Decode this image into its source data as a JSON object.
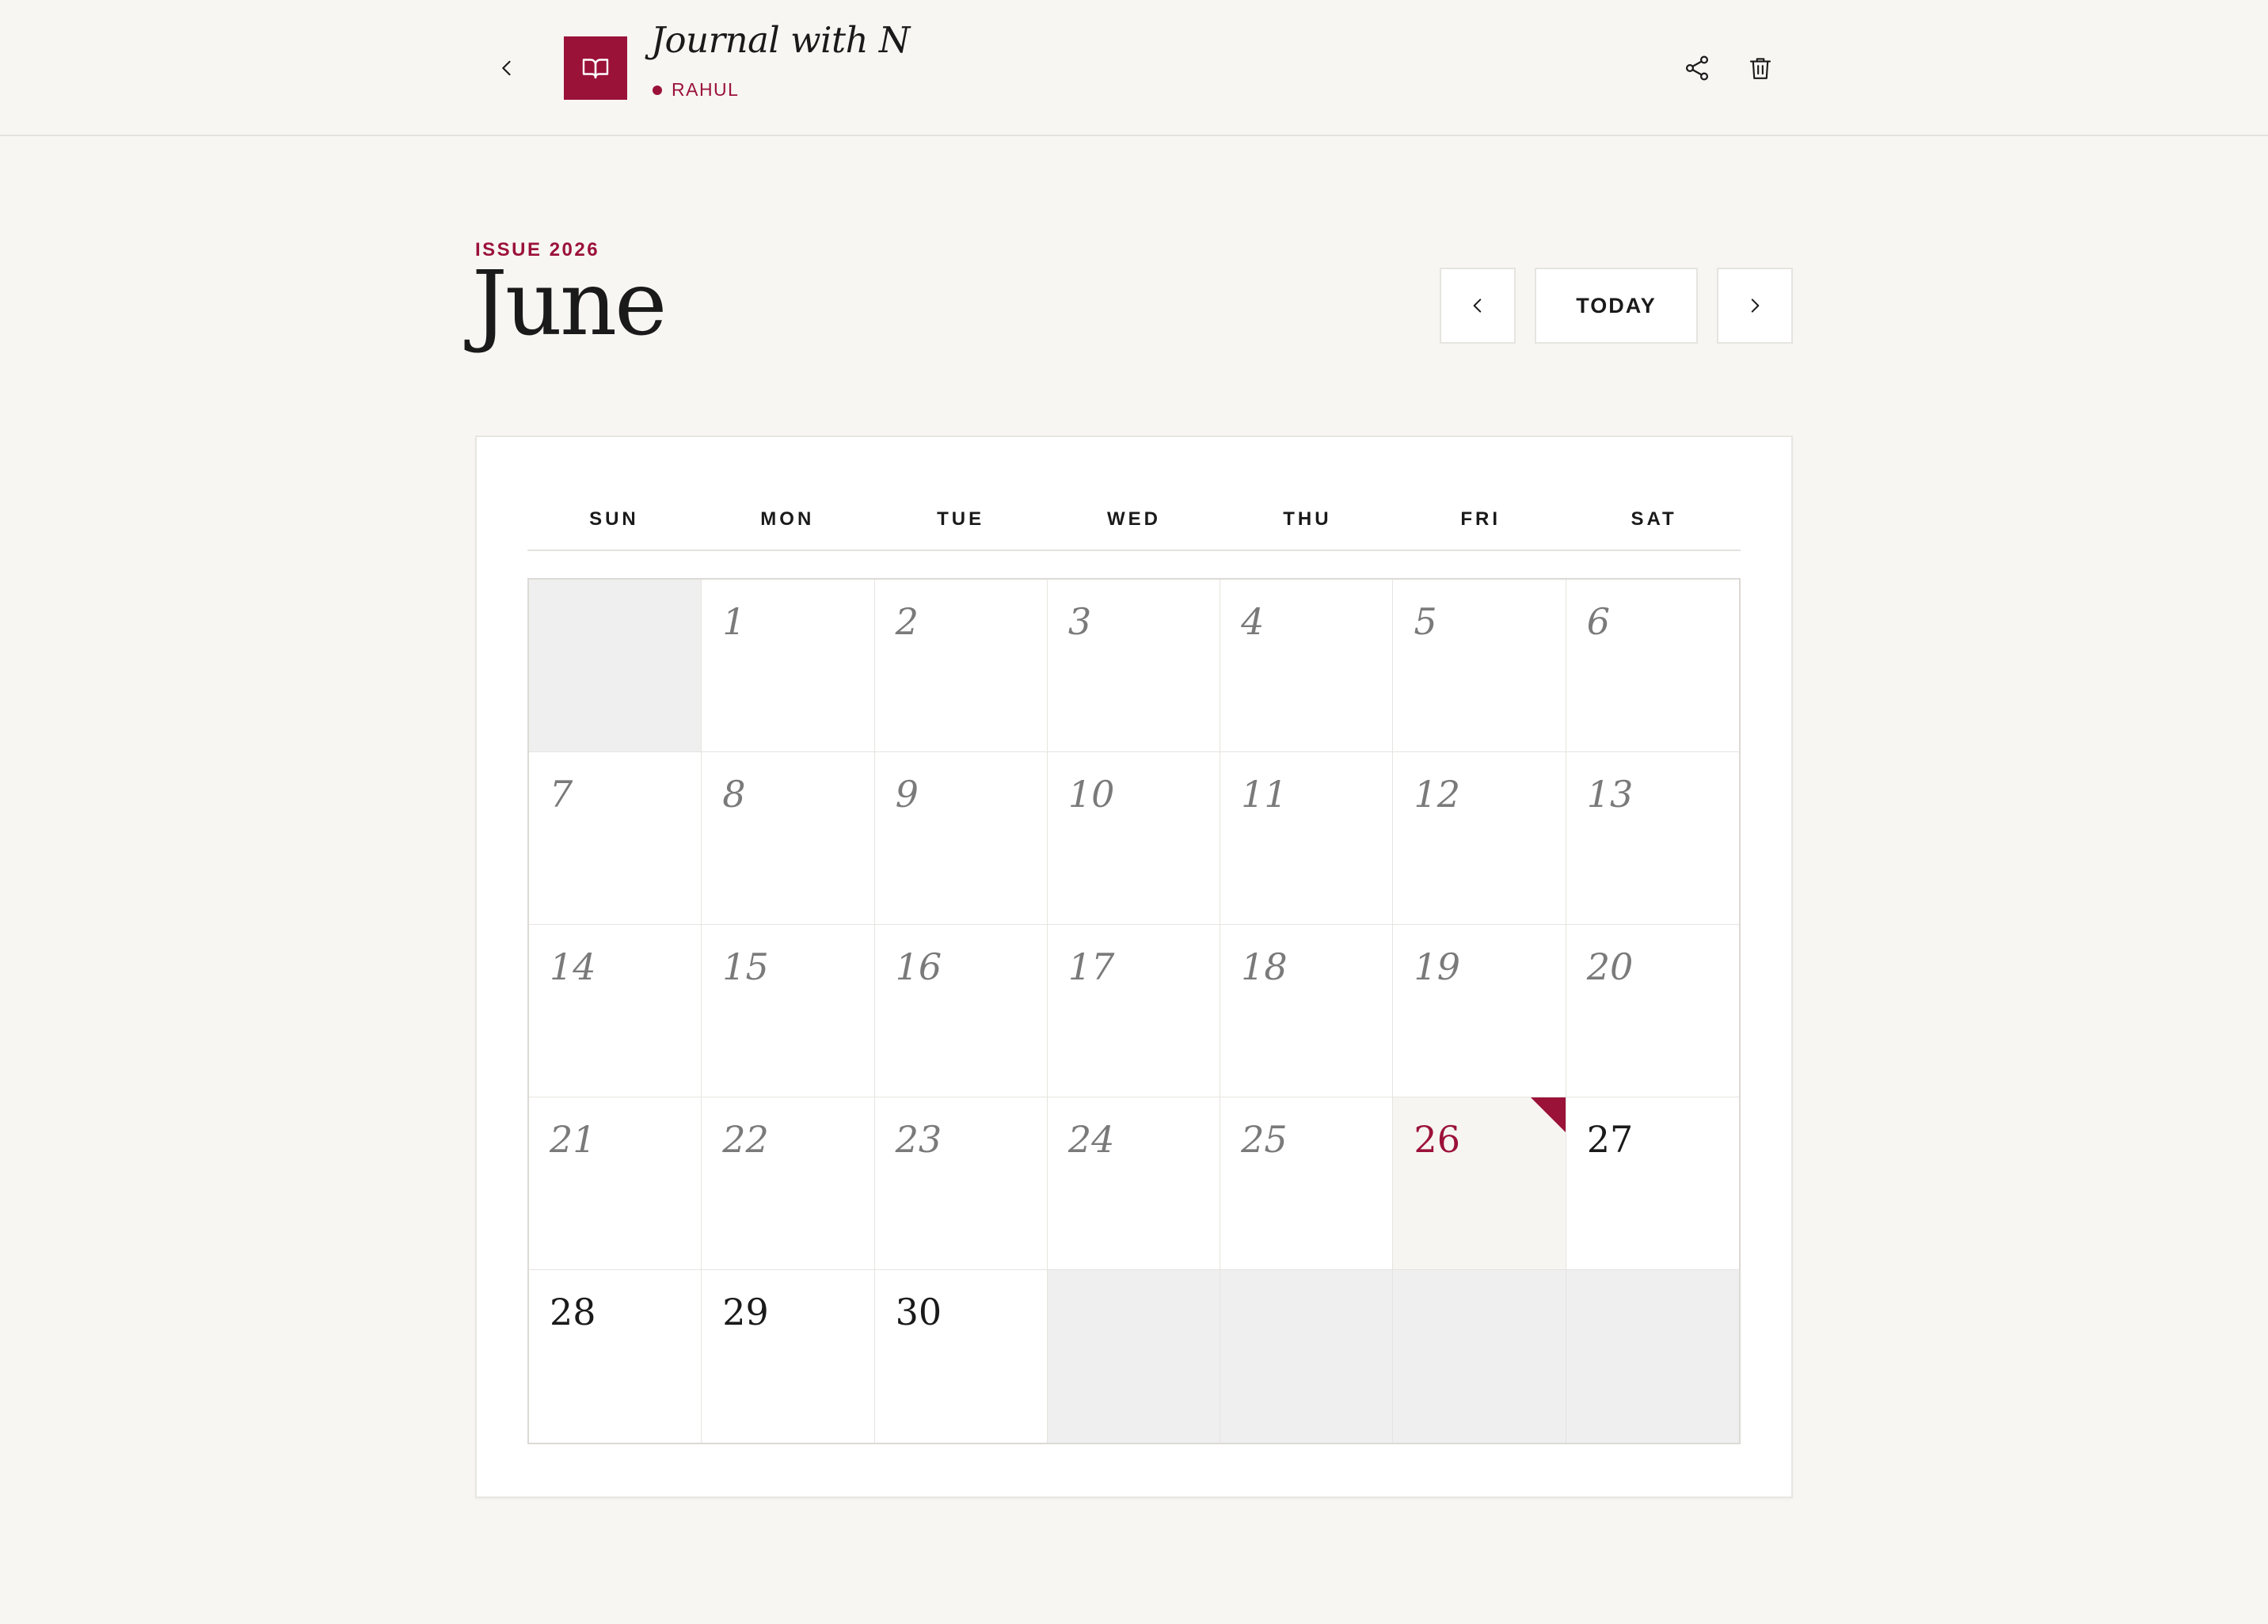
{
  "header": {
    "journal_title": "Journal with N",
    "owner": "RAHUL",
    "icons": {
      "back": "chevron-left-icon",
      "logo": "book-open-icon",
      "share": "share-icon",
      "delete": "trash-icon"
    }
  },
  "calendar": {
    "issue_label": "ISSUE 2026",
    "month": "June",
    "today_label": "TODAY",
    "weekdays": [
      "SUN",
      "MON",
      "TUE",
      "WED",
      "THU",
      "FRI",
      "SAT"
    ],
    "today": 26,
    "days_in_month": 30,
    "first_weekday_index": 1
  },
  "colors": {
    "accent": "#9b1239",
    "background": "#f7f6f3",
    "card": "#ffffff",
    "empty_cell": "#efefef",
    "past_text": "#7a7a7a",
    "text": "#1a1a1a"
  }
}
